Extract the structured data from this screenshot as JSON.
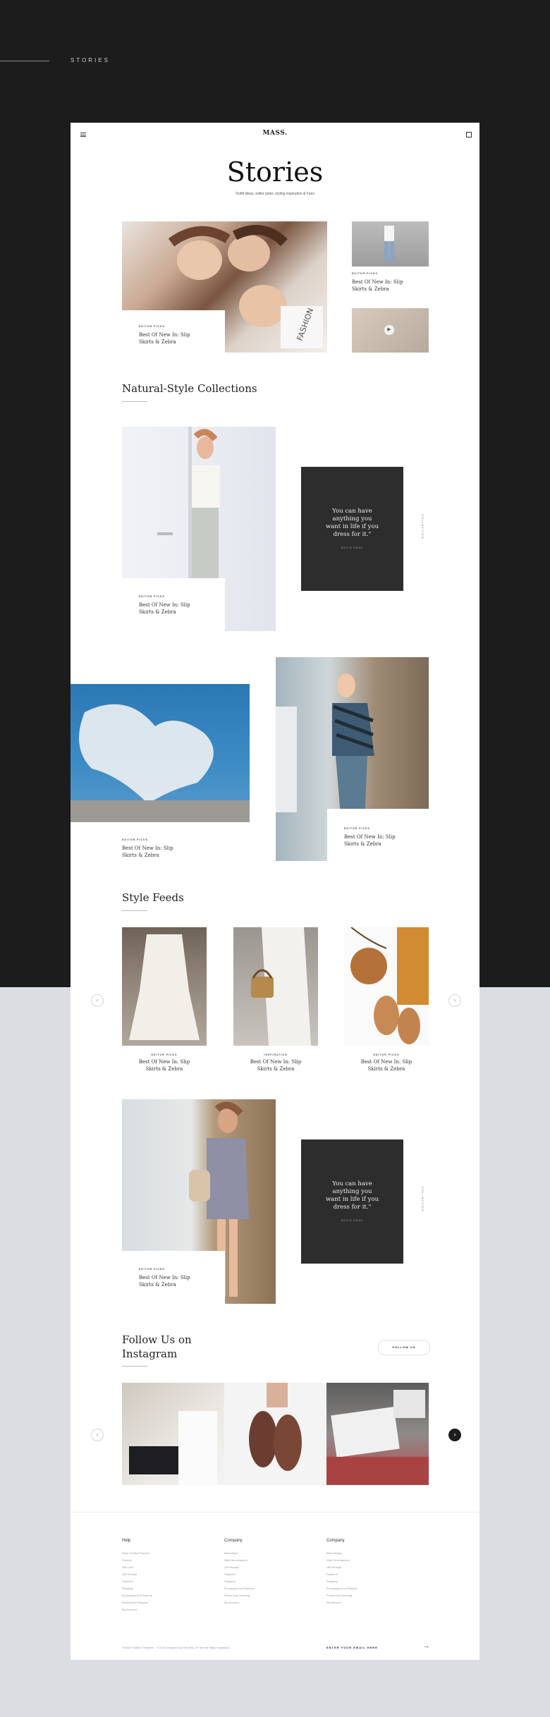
{
  "header": {
    "section_label": "STORIES"
  },
  "site": {
    "logo": "MASS.",
    "menu_icon": "hamburger-icon",
    "bag_icon": "shopping-bag-icon"
  },
  "hero": {
    "title": "Stories",
    "subtitle": "Outfit ideas, editor picks, styling inspiration & Fans"
  },
  "featured": {
    "main": {
      "kicker": "EDITOR PICKS",
      "title_l1": "Best Of New In: Slip",
      "title_l2": "Skirts & Zebra"
    },
    "side": {
      "kicker": "EDITOR PICKS",
      "title_l1": "Best Of New In: Slip",
      "title_l2": "Skirts & Zebra"
    }
  },
  "natural": {
    "title": "Natural-Style Collections",
    "card1": {
      "kicker": "EDITOR PICKS",
      "title_l1": "Best Of New In: Slip",
      "title_l2": "Skirts & Zebra"
    },
    "quote": {
      "l1": "You can have",
      "l2": "anything you",
      "l3": "want in life if you",
      "l4": "dress for it.\"",
      "author": "EDITH HEAD"
    },
    "vertical_label": "COLLECTION",
    "card2": {
      "kicker": "EDITOR PICKS",
      "title_l1": "Best Of New In: Slip",
      "title_l2": "Skirts & Zebra"
    },
    "card3": {
      "kicker": "EDITOR PICKS",
      "title_l1": "Best Of New In: Slip",
      "title_l2": "Skirts & Zebra"
    }
  },
  "feeds": {
    "title": "Style Feeds",
    "items": [
      {
        "kicker": "EDITOR PICKS",
        "title_l1": "Best Of New In: Slip",
        "title_l2": "Skirts & Zebra"
      },
      {
        "kicker": "INSPIRATION",
        "title_l1": "Best Of New In: Slip",
        "title_l2": "Skirts & Zebra"
      },
      {
        "kicker": "EDITOR PICKS",
        "title_l1": "Best Of New In: Slip",
        "title_l2": "Skirts & Zebra"
      }
    ],
    "card4": {
      "kicker": "EDITOR PICKS",
      "title_l1": "Best Of New In: Slip",
      "title_l2": "Skirts & Zebra"
    },
    "quote": {
      "l1": "You can have",
      "l2": "anything you",
      "l3": "want in life if you",
      "l4": "dress for it.\"",
      "author": "EDITH HEAD"
    },
    "vertical_label": "COLLECTION"
  },
  "instagram": {
    "title_l1": "Follow Us on",
    "title_l2": "Instagram",
    "button": "FOLLOW US"
  },
  "footer": {
    "cols": [
      {
        "title": "Help",
        "links": [
          "Shop All New Fashion",
          "Product",
          "Gift Card",
          "Gift Receipt",
          "Payment",
          "Shipping",
          "Exchanges And Returns",
          "Rental And Cleaning",
          "My Account"
        ]
      },
      {
        "title": "Company",
        "links": [
          "New Major",
          "Web Development",
          "Gift Receipt",
          "Payment",
          "Shipping",
          "Exchanges And Returns",
          "Prices And Cleaning",
          "My Account"
        ]
      },
      {
        "title": "Company",
        "links": [
          "Web Design",
          "Web Development",
          "Gift Receipt",
          "Payment",
          "Shipping",
          "Exchanges And Returns",
          "Prices And Cleaning",
          "My Account"
        ]
      }
    ],
    "copyright": "Fashion Sketch Template · © 2018 Designed by Tran Mau Tri Tam for Mass Inspiration",
    "email_label": "ENTER YOUR EMAIL HERE"
  }
}
